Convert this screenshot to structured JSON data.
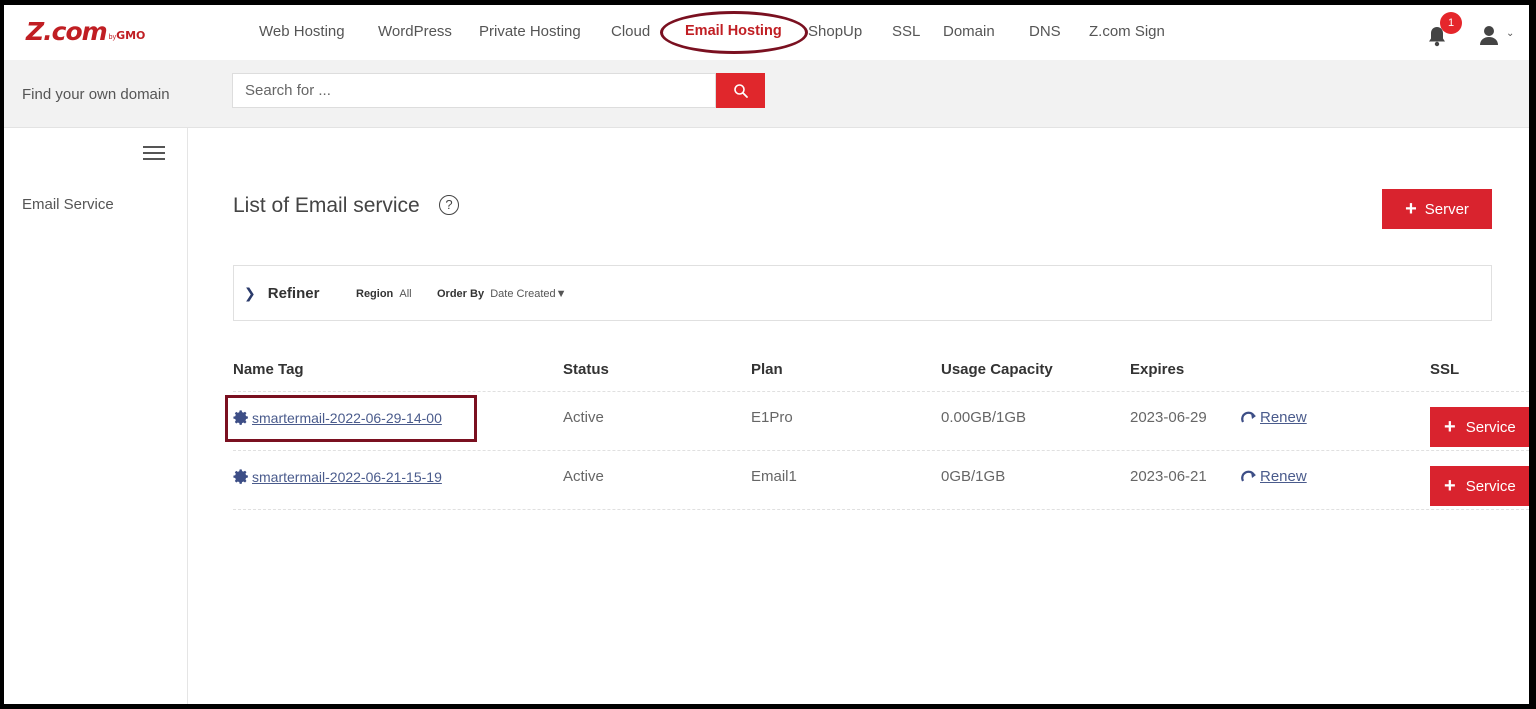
{
  "logo": {
    "main": "Z.com",
    "by": "by",
    "gmo": "GMO"
  },
  "nav": [
    {
      "label": "Web Hosting"
    },
    {
      "label": "WordPress"
    },
    {
      "label": "Private Hosting"
    },
    {
      "label": "Cloud"
    },
    {
      "label": "Email Hosting",
      "active": true
    },
    {
      "label": "ShopUp"
    },
    {
      "label": "SSL"
    },
    {
      "label": "Domain"
    },
    {
      "label": "DNS"
    },
    {
      "label": "Z.com Sign"
    }
  ],
  "notifications": {
    "count": "1",
    "icon": "bell-icon"
  },
  "search": {
    "label": "Find your own domain",
    "placeholder": "Search for ..."
  },
  "sidebar": {
    "items": [
      {
        "label": "Email Service"
      }
    ]
  },
  "main": {
    "title": "List of Email service",
    "help": "?",
    "add_server_label": "Server",
    "refiner": {
      "label": "Refiner",
      "region_label": "Region",
      "region_value": "All",
      "order_label": "Order By",
      "order_value": "Date Created▼"
    },
    "columns": [
      "Name Tag",
      "Status",
      "Plan",
      "Usage Capacity",
      "Expires",
      "SSL"
    ],
    "rows": [
      {
        "name": "smartermail-2022-06-29-14-00",
        "status": "Active",
        "plan": "E1Pro",
        "usage": "0.00GB/1GB",
        "expires": "2023-06-29",
        "renew": "Renew",
        "service": "Service"
      },
      {
        "name": "smartermail-2022-06-21-15-19",
        "status": "Active",
        "plan": "Email1",
        "usage": "0GB/1GB",
        "expires": "2023-06-21",
        "renew": "Renew",
        "service": "Service"
      }
    ]
  },
  "colors": {
    "brand_red": "#d9232e",
    "link": "#4a5b8c",
    "annotation": "#7a1020"
  }
}
